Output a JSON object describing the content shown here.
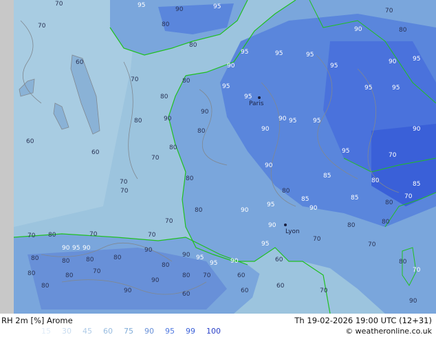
{
  "header": {
    "product": "RH 2m [%] Arome",
    "datetime": "Th 19-02-2026 19:00 UTC (12+31)",
    "credit": "© weatheronline.co.uk"
  },
  "legend": [
    {
      "value": "15",
      "color": "#e0ecf8"
    },
    {
      "value": "30",
      "color": "#c8dcf0"
    },
    {
      "value": "45",
      "color": "#b0cce8"
    },
    {
      "value": "60",
      "color": "#98bce0"
    },
    {
      "value": "75",
      "color": "#80acd8"
    },
    {
      "value": "90",
      "color": "#6890d8"
    },
    {
      "value": "95",
      "color": "#4f78e0"
    },
    {
      "value": "99",
      "color": "#3a60d8"
    },
    {
      "value": "100",
      "color": "#2a40c8"
    }
  ],
  "cities": {
    "paris": "Paris",
    "lyon": "Lyon"
  },
  "contours": {
    "sea_60": "60",
    "sea_70": "70",
    "n_95": "95",
    "n_90": "90",
    "n_85": "85",
    "n_80": "80",
    "n_70": "70"
  },
  "colors": {
    "sea": "#9cc4de",
    "land_low": "#7aa6dc",
    "land_high": "#4a72dc",
    "border": "#20c020",
    "contour": "#808890",
    "outside": "#c8c8c8"
  }
}
